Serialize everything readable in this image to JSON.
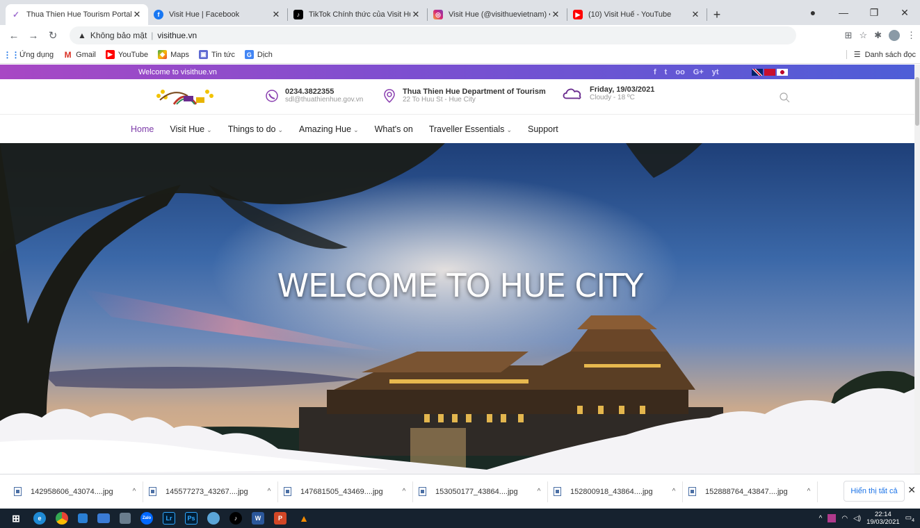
{
  "browser": {
    "tabs": [
      {
        "title": "Thua Thien Hue Tourism Portal",
        "icon": "visithue-favicon",
        "active": true
      },
      {
        "title": "Visit Hue | Facebook",
        "icon": "facebook-icon",
        "active": false
      },
      {
        "title": "TikTok Chính thức của Visit Hue (",
        "icon": "tiktok-icon",
        "active": false
      },
      {
        "title": "Visit Hue (@visithuevietnam) • Â",
        "icon": "instagram-icon",
        "active": false
      },
      {
        "title": "(10) Visit Huế - YouTube",
        "icon": "youtube-icon",
        "active": false
      }
    ],
    "new_tab": "+",
    "security_label": "Không bảo mật",
    "url": "visithue.vn",
    "bookmarks": [
      {
        "label": "Ứng dụng",
        "icon": "apps-grid-icon"
      },
      {
        "label": "Gmail",
        "icon": "gmail-icon"
      },
      {
        "label": "YouTube",
        "icon": "youtube-icon"
      },
      {
        "label": "Maps",
        "icon": "maps-icon"
      },
      {
        "label": "Tin tức",
        "icon": "news-icon"
      },
      {
        "label": "Dịch",
        "icon": "translate-icon"
      }
    ],
    "reading_list": "Danh sách đọc"
  },
  "site": {
    "topbar_welcome": "Welcome to visithue.vn",
    "social": [
      "f",
      "t",
      "oo",
      "G+",
      "yt"
    ],
    "phone": "0234.3822355",
    "email": "sdl@thuathienhue.gov.vn",
    "department": "Thua Thien Hue Department of Tourism",
    "address": "22 To Huu St - Hue City",
    "date": "Friday, 19/03/2021",
    "weather": "Cloudy - 18 ºC",
    "nav": [
      {
        "label": "Home",
        "dropdown": false,
        "active": true
      },
      {
        "label": "Visit Hue",
        "dropdown": true,
        "active": false
      },
      {
        "label": "Things to do",
        "dropdown": true,
        "active": false
      },
      {
        "label": "Amazing Hue",
        "dropdown": true,
        "active": false
      },
      {
        "label": "What's on",
        "dropdown": false,
        "active": false
      },
      {
        "label": "Traveller Essentials",
        "dropdown": true,
        "active": false
      },
      {
        "label": "Support",
        "dropdown": false,
        "active": false
      }
    ],
    "hero_title": "WELCOME TO HUE CITY"
  },
  "downloads": {
    "items": [
      "142958606_43074....jpg",
      "145577273_43267....jpg",
      "147681505_43469....jpg",
      "153050177_43864....jpg",
      "152800918_43864....jpg",
      "152888764_43847....jpg"
    ],
    "show_all": "Hiển thị tất cả"
  },
  "taskbar": {
    "time": "22:14",
    "date": "19/03/2021",
    "notification_count": "4"
  },
  "colors": {
    "accent": "#7c3aa8",
    "topbar_start": "#a848c4",
    "topbar_end": "#4d5ed7"
  }
}
